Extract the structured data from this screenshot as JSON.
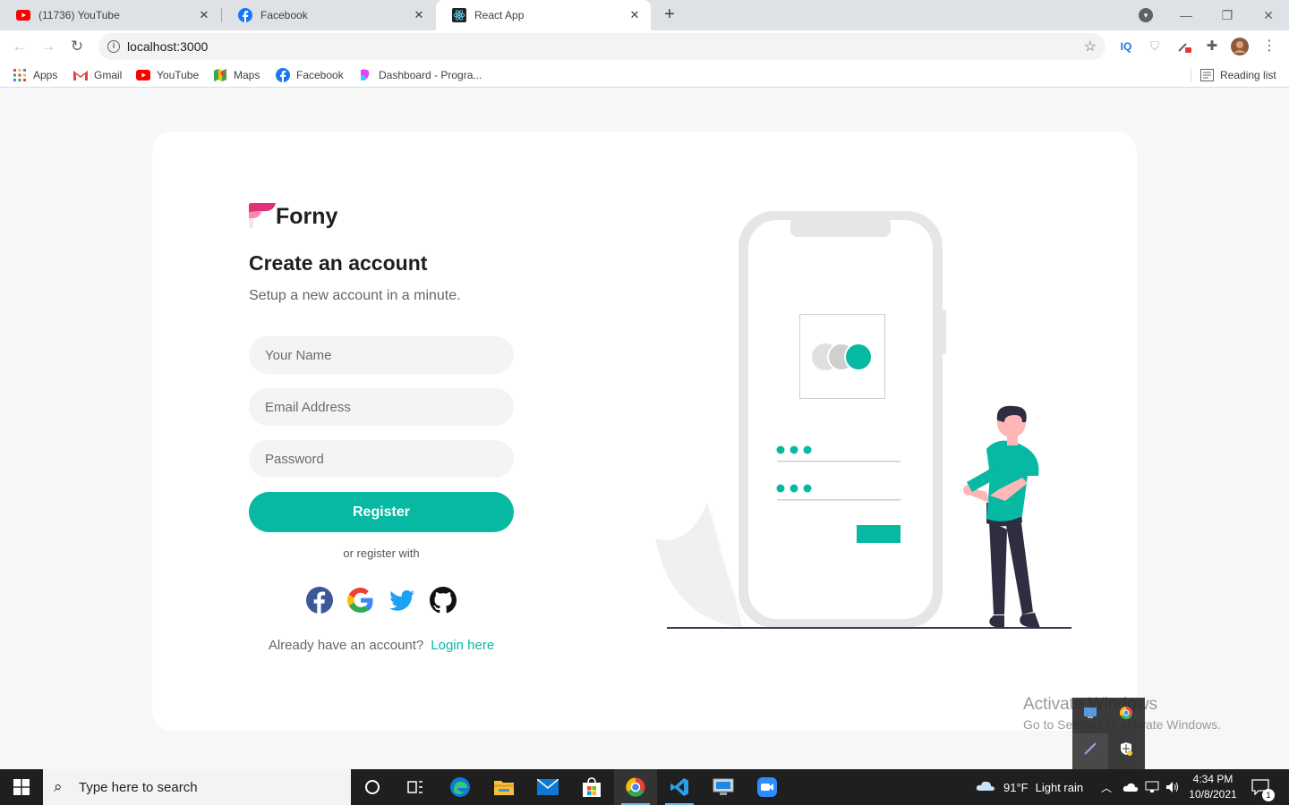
{
  "browser": {
    "tabs": [
      {
        "title": "(11736) YouTube",
        "icon": "youtube-icon"
      },
      {
        "title": "Facebook",
        "icon": "facebook-icon"
      },
      {
        "title": "React App",
        "icon": "react-icon",
        "active": true
      }
    ],
    "url": "localhost:3000",
    "bookmarks": [
      {
        "label": "Apps",
        "icon": "apps-grid-icon"
      },
      {
        "label": "Gmail",
        "icon": "gmail-icon"
      },
      {
        "label": "YouTube",
        "icon": "youtube-icon"
      },
      {
        "label": "Maps",
        "icon": "maps-icon"
      },
      {
        "label": "Facebook",
        "icon": "facebook-icon"
      },
      {
        "label": "Dashboard - Progra...",
        "icon": "dashboard-icon"
      }
    ],
    "reading_list": "Reading list",
    "extensions": [
      "IQ",
      "shield",
      "eyedropper",
      "puzzle",
      "profile",
      "menu"
    ]
  },
  "form": {
    "brand": "Forny",
    "title": "Create an account",
    "subtitle": "Setup a new account in a minute.",
    "name_placeholder": "Your Name",
    "email_placeholder": "Email Address",
    "password_placeholder": "Password",
    "register_label": "Register",
    "or_register_with": "or register with",
    "social": [
      "facebook",
      "google",
      "twitter",
      "github"
    ],
    "already_text": "Already have an account?",
    "login_link": "Login here"
  },
  "watermark": {
    "line1": "Activate Windows",
    "line2": "Go to Settings to activate Windows."
  },
  "taskbar": {
    "search_placeholder": "Type here to search",
    "weather_temp": "91°F",
    "weather_text": "Light rain",
    "time": "4:34 PM",
    "date": "10/8/2021",
    "notification_count": "1"
  },
  "colors": {
    "accent": "#07b9a2",
    "brand_pink": "#e0317a",
    "page_bg": "#f7f7f7"
  }
}
